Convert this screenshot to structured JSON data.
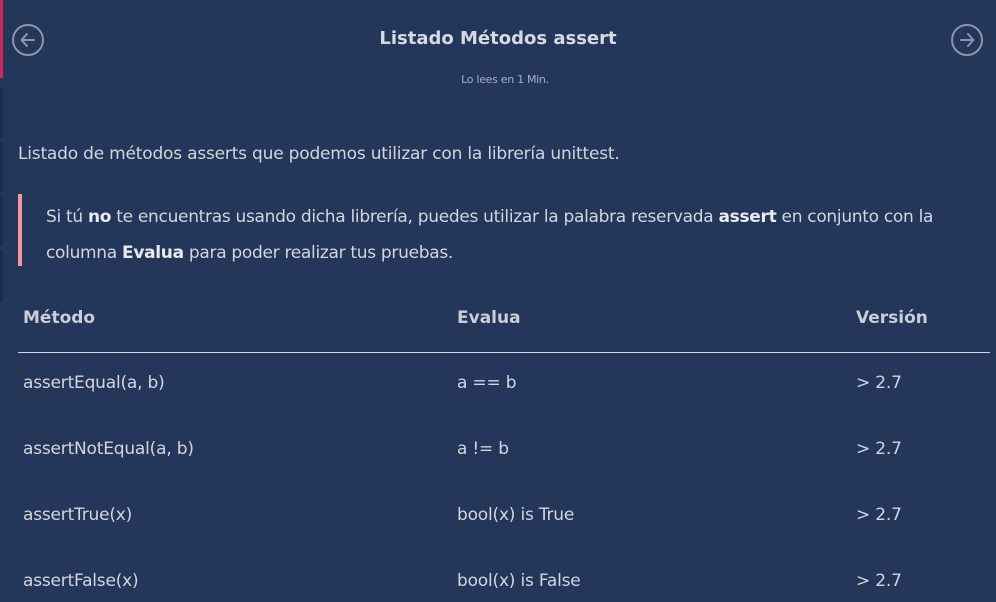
{
  "header": {
    "title": "Listado Métodos assert",
    "reading_time": "Lo lees en 1 Min."
  },
  "content": {
    "intro": "Listado de métodos asserts que podemos utilizar con la librería unittest.",
    "note": {
      "part1": "Si tú ",
      "bold1": "no",
      "part2": " te encuentras usando dicha librería, puedes utilizar la palabra reservada ",
      "bold2": "assert",
      "part3": " en conjunto con la columna ",
      "bold3": "Evalua",
      "part4": " para poder realizar tus pruebas."
    }
  },
  "table": {
    "headers": [
      "Método",
      "Evalua",
      "Versión"
    ],
    "rows": [
      [
        "assertEqual(a, b)",
        "a == b",
        "> 2.7"
      ],
      [
        "assertNotEqual(a, b)",
        "a != b",
        "> 2.7"
      ],
      [
        "assertTrue(x)",
        "bool(x) is True",
        "> 2.7"
      ],
      [
        "assertFalse(x)",
        "bool(x) is False",
        "> 2.7"
      ]
    ]
  },
  "icons": {
    "prev": "arrow-left-circle-icon",
    "next": "arrow-right-circle-icon"
  },
  "colors": {
    "background": "#243659",
    "accent": "#d1285a",
    "quote_border": "#f29aa0"
  }
}
